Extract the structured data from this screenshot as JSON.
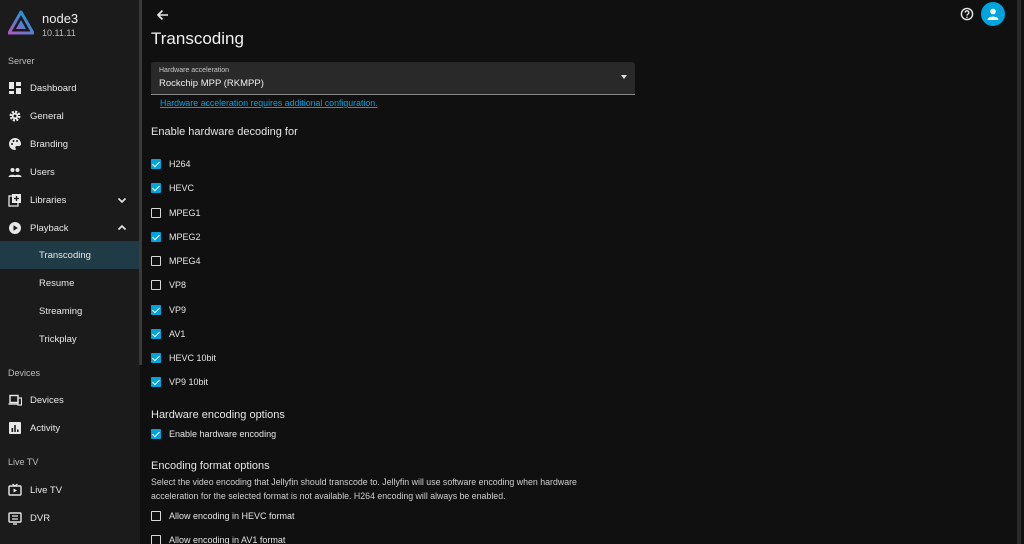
{
  "server": {
    "name": "node3",
    "version": "10.11.11"
  },
  "sidebar": {
    "sections": {
      "server": "Server",
      "devices": "Devices",
      "livetv": "Live TV"
    },
    "items": {
      "dashboard": "Dashboard",
      "general": "General",
      "branding": "Branding",
      "users": "Users",
      "libraries": "Libraries",
      "playback": "Playback",
      "transcoding": "Transcoding",
      "resume": "Resume",
      "streaming": "Streaming",
      "trickplay": "Trickplay",
      "devices": "Devices",
      "activity": "Activity",
      "livetv": "Live TV",
      "dvr": "DVR"
    },
    "active_item": "Transcoding"
  },
  "page": {
    "title": "Transcoding"
  },
  "hw_accel": {
    "label": "Hardware acceleration",
    "value": "Rockchip MPP (RKMPP)",
    "helper_link": "Hardware acceleration requires additional configuration."
  },
  "decoding": {
    "heading": "Enable hardware decoding for",
    "codecs": [
      {
        "label": "H264",
        "checked": true
      },
      {
        "label": "HEVC",
        "checked": true
      },
      {
        "label": "MPEG1",
        "checked": false
      },
      {
        "label": "MPEG2",
        "checked": true
      },
      {
        "label": "MPEG4",
        "checked": false
      },
      {
        "label": "VP8",
        "checked": false
      },
      {
        "label": "VP9",
        "checked": true
      },
      {
        "label": "AV1",
        "checked": true
      },
      {
        "label": "HEVC 10bit",
        "checked": true
      },
      {
        "label": "VP9 10bit",
        "checked": true
      }
    ]
  },
  "encoding": {
    "heading": "Hardware encoding options",
    "enable_label": "Enable hardware encoding",
    "enable_checked": true
  },
  "format": {
    "heading": "Encoding format options",
    "description": "Select the video encoding that Jellyfin should transcode to. Jellyfin will use software encoding when hardware acceleration for the selected format is not available. H264 encoding will always be enabled.",
    "hevc_label": "Allow encoding in HEVC format",
    "hevc_checked": false,
    "av1_label": "Allow encoding in AV1 format",
    "av1_checked": false
  },
  "colors": {
    "accent": "#00a4dc",
    "sidebar_bg": "#1b1b1b",
    "page_bg": "#101010",
    "active_bg": "#1f3b45"
  }
}
